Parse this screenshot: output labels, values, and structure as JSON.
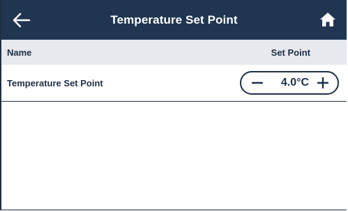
{
  "header": {
    "title": "Temperature Set Point",
    "back_icon": "arrow-left-icon",
    "home_icon": "home-icon"
  },
  "table": {
    "columns": [
      "Name",
      "Set Point"
    ],
    "rows": [
      {
        "name": "Temperature Set Point",
        "value": "4.0°C"
      }
    ]
  },
  "colors": {
    "header_bg": "#1f3550",
    "header_text": "#ffffff",
    "column_header_bg": "#e6e9ee",
    "text": "#1f2f44"
  }
}
